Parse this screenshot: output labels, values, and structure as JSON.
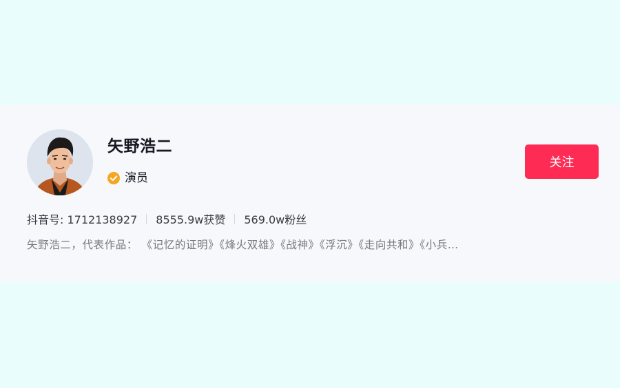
{
  "profile": {
    "name": "矢野浩二",
    "verify_label": "演员",
    "follow_label": "关注",
    "stats": {
      "douyin_id": "抖音号: 1712138927",
      "likes": "8555.9w获赞",
      "followers": "569.0w粉丝"
    },
    "bio": "矢野浩二，代表作品：  《记忆的证明》《烽火双雄》《战神》《浮沉》《走向共和》《小兵…"
  },
  "colors": {
    "page_background": "#e9fdfd",
    "card_background": "#f7f8fb",
    "follow_button": "#fe2c55",
    "verify_badge": "#f5a623",
    "name_text": "#161823",
    "bio_text": "#75777d"
  },
  "icons": {
    "verify": "check-badge-icon"
  }
}
